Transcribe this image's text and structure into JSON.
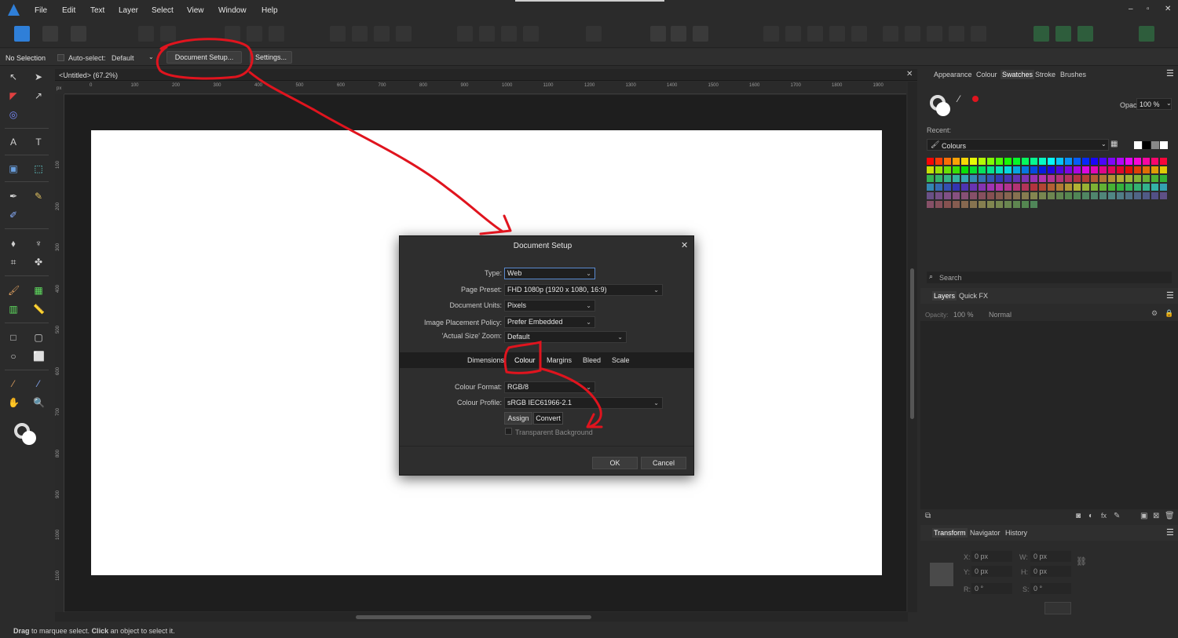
{
  "menubar": {
    "items": [
      "File",
      "Edit",
      "Text",
      "Layer",
      "Select",
      "View",
      "Window",
      "Help"
    ],
    "window_controls": [
      "–",
      "▫",
      "✕"
    ]
  },
  "context_toolbar": {
    "selection_label": "No Selection",
    "autoselect_label": "Auto-select:",
    "autoselect_value": "Default",
    "document_setup_label": "Document Setup...",
    "settings_label": "Settings..."
  },
  "document": {
    "tab_title": "<Untitled> (67.2%)",
    "ruler_unit": "px",
    "hruler_ticks": [
      "0",
      "100",
      "200",
      "300",
      "400",
      "500",
      "600",
      "700",
      "800",
      "900",
      "1000",
      "1100",
      "1200",
      "1300",
      "1400",
      "1500",
      "1600",
      "1700",
      "1800",
      "1900"
    ],
    "vruler_ticks": [
      "100",
      "200",
      "300",
      "400",
      "500",
      "600",
      "700",
      "800",
      "900",
      "1000",
      "1100"
    ]
  },
  "status": {
    "drag": "Drag",
    "drag_text": " to marquee select. ",
    "click": "Click",
    "click_text": " an object to select it."
  },
  "right_panel": {
    "tabs": [
      "Appearance",
      "Colour",
      "Swatches",
      "Stroke",
      "Brushes"
    ],
    "active_tab": "Swatches",
    "opacity_label": "Opacity:",
    "opacity_value": "100 %",
    "recent_label": "Recent:",
    "palette_name": "Colours",
    "search_placeholder": "Search",
    "layers_tabs": [
      "Layers",
      "Quick FX"
    ],
    "layers_opacity_label": "Opacity:",
    "layers_opacity_value": "100 %",
    "blend_mode": "Normal",
    "transform_tabs": [
      "Transform",
      "Navigator",
      "History"
    ],
    "transform": {
      "x_label": "X:",
      "x_value": "0 px",
      "y_label": "Y:",
      "y_value": "0 px",
      "w_label": "W:",
      "w_value": "0 px",
      "h_label": "H:",
      "h_value": "0 px",
      "r_label": "R:",
      "r_value": "0 °",
      "s_label": "S:",
      "s_value": "0 °"
    }
  },
  "dialog": {
    "title": "Document Setup",
    "type_label": "Type:",
    "type_value": "Web",
    "preset_label": "Page Preset:",
    "preset_value": "FHD 1080p  (1920 x 1080, 16:9)",
    "units_label": "Document Units:",
    "units_value": "Pixels",
    "placement_label": "Image Placement Policy:",
    "placement_value": "Prefer Embedded",
    "zoom_label": "'Actual Size' Zoom:",
    "zoom_value": "Default",
    "tabs": [
      "Dimensions",
      "Colour",
      "Margins",
      "Bleed",
      "Scale"
    ],
    "colour_format_label": "Colour Format:",
    "colour_format_value": "RGB/8",
    "colour_profile_label": "Colour Profile:",
    "colour_profile_value": "sRGB IEC61966-2.1",
    "assign_label": "Assign",
    "convert_label": "Convert",
    "transparent_label": "Transparent Background",
    "ok_label": "OK",
    "cancel_label": "Cancel"
  },
  "colors": {
    "annotation_red": "#e0141e",
    "accent_blue": "#2f7fd8"
  }
}
